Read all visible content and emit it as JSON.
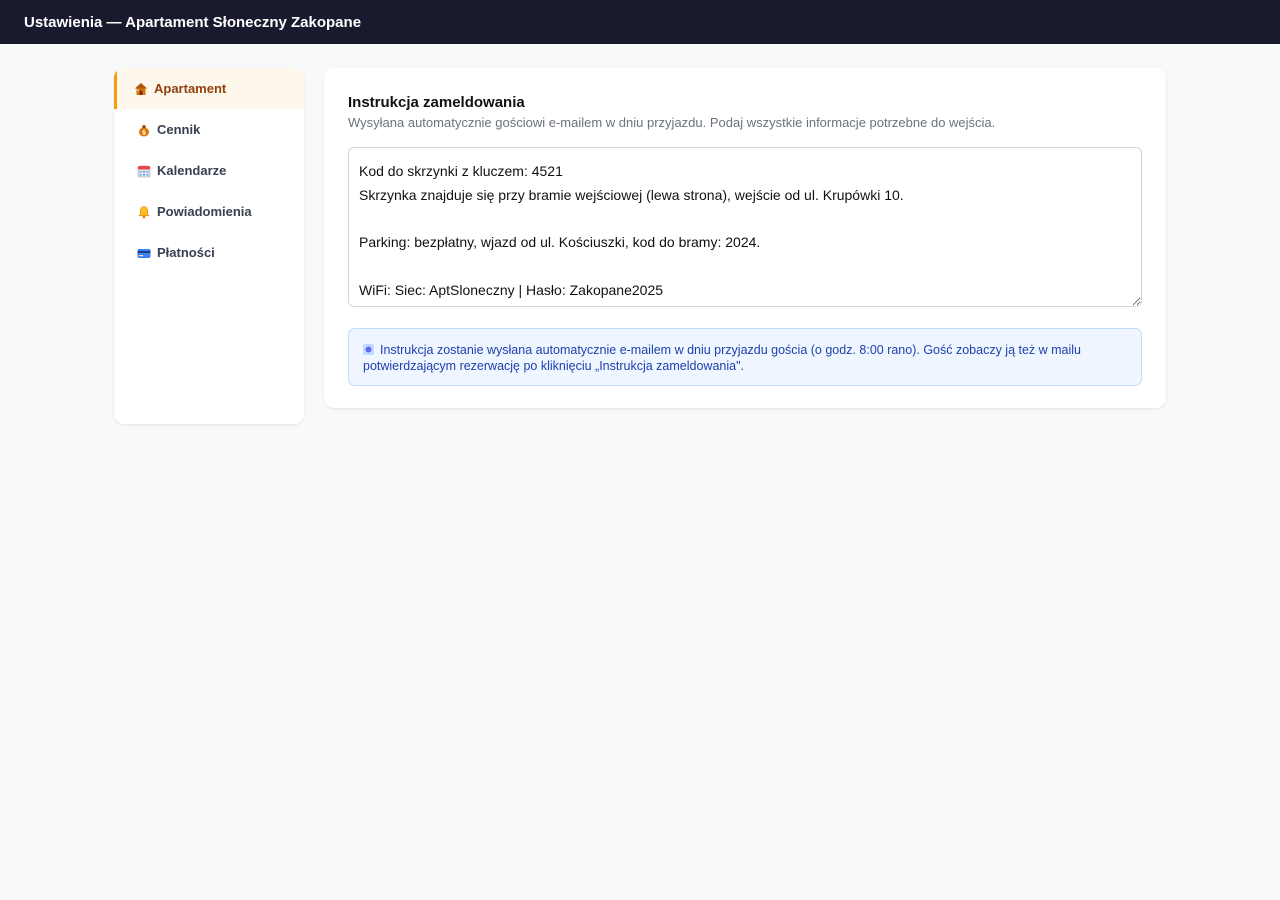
{
  "header": {
    "title": "Ustawienia — Apartament Słoneczny Zakopane"
  },
  "sidebar": {
    "items": [
      {
        "label": "Apartament",
        "icon": "house-icon",
        "active": true
      },
      {
        "label": "Cennik",
        "icon": "money-bag-icon",
        "active": false
      },
      {
        "label": "Kalendarze",
        "icon": "calendar-icon",
        "active": false
      },
      {
        "label": "Powiadomienia",
        "icon": "bell-icon",
        "active": false
      },
      {
        "label": "Płatności",
        "icon": "credit-card-icon",
        "active": false
      }
    ]
  },
  "checkin": {
    "title": "Instrukcja zameldowania",
    "subtitle": "Wysyłana automatycznie gościowi e-mailem w dniu przyjazdu. Podaj wszystkie informacje potrzebne do wejścia.",
    "instructions_value": "Kod do skrzynki z kluczem: 4521\nSkrzynka znajduje się przy bramie wejściowej (lewa strona), wejście od ul. Krupówki 10.\n\nParking: bezpłatny, wjazd od ul. Kościuszki, kod do bramy: 2024.\n\nWiFi: Siec: AptSloneczny | Hasło: Zakopane2025",
    "info_text": "Instrukcja zostanie wysłana automatycznie e-mailem w dniu przyjazdu gościa (o godz. 8:00 rano). Gość zobaczy ją też w mailu potwierdzającym rezerwację po kliknięciu „Instrukcja zameldowania\"."
  },
  "colors": {
    "topbar_bg": "#1a1a2e",
    "accent": "#f59e0b",
    "info_bg": "#eff6ff",
    "info_text": "#1e40af"
  }
}
